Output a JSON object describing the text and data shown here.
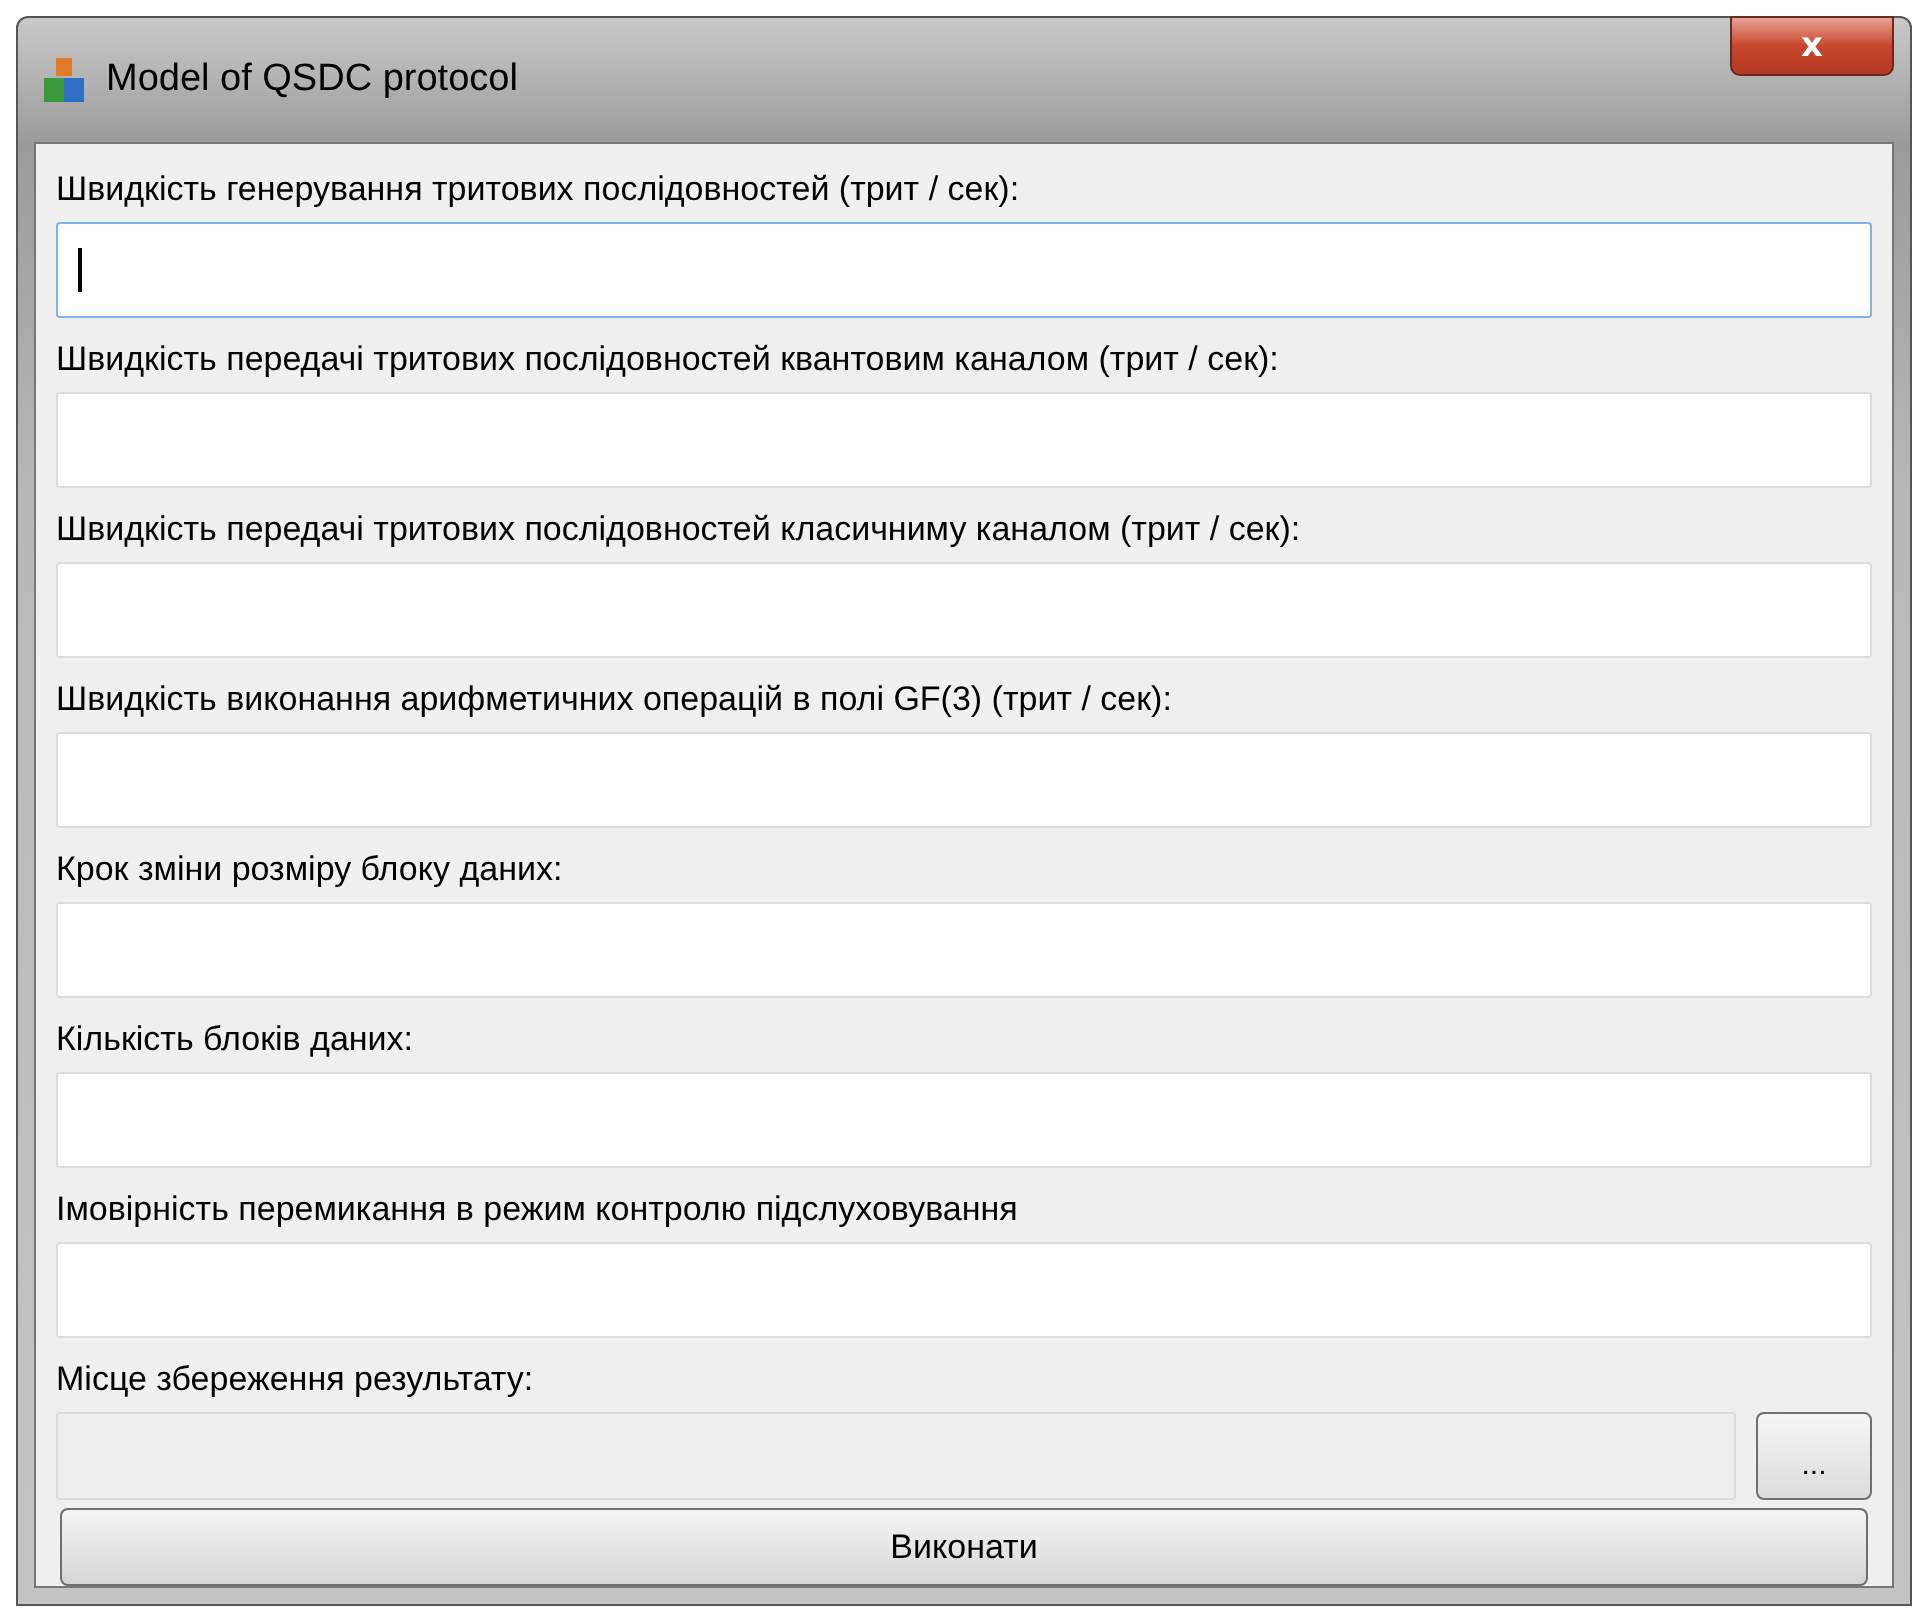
{
  "window": {
    "title": "Model of QSDC protocol",
    "close": "x"
  },
  "fields": [
    {
      "label": "Швидкість генерування тритових послідовностей (трит / сек):",
      "focused": true
    },
    {
      "label": "Швидкість передачі тритових послідовностей квантовим каналом (трит / сек):",
      "focused": false
    },
    {
      "label": "Швидкість передачі тритових послідовностей класичниму каналом (трит / сек):",
      "focused": false
    },
    {
      "label": "Швидкість виконання арифметичних операцій в полі GF(3) (трит / сек):",
      "focused": false
    },
    {
      "label": "Крок зміни розміру блоку даних:",
      "focused": false
    },
    {
      "label": "Кількість блоків даних:",
      "focused": false
    },
    {
      "label": "Імовірність перемикання в режим контролю підслуховування",
      "focused": false
    }
  ],
  "output": {
    "label": "Місце збереження результату:",
    "disabled": true,
    "browse": "..."
  },
  "run_button": "Виконати"
}
